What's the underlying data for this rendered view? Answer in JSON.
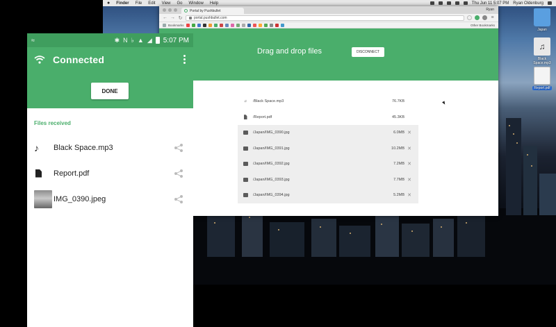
{
  "colors": {
    "pushbullet_green": "#4aae6b",
    "status_green": "#3f9e5e"
  },
  "mac": {
    "menubar": {
      "apple": "",
      "app": "Finder",
      "menus": [
        "File",
        "Edit",
        "View",
        "Go",
        "Window",
        "Help"
      ],
      "clock": "Thu Jun 11 5:07 PM",
      "user": "Ryan Oldenburg"
    },
    "desktop_icons": [
      {
        "label": "Japan",
        "icon": "folder-icon"
      },
      {
        "label": "Black Space.mp3",
        "icon": "audio-file-icon"
      },
      {
        "label": "Report.pdf",
        "icon": "pdf-file-icon"
      }
    ]
  },
  "browser": {
    "tab_title": "Portal by Pushbullet",
    "user": "Ryan",
    "url": "portal.pushbullet.com",
    "bookmarks_label": "Bookmarks",
    "other_bookmarks": "Other Bookmarks",
    "portal": {
      "title": "Drag and drop files",
      "disconnect_label": "DISCONNECT",
      "files": [
        {
          "name": "/Black Space.mp3",
          "size": "76.7KB",
          "type": "audio",
          "removable": false
        },
        {
          "name": "/Report.pdf",
          "size": "45.3KB",
          "type": "document",
          "removable": false
        },
        {
          "name": "/Japan/IMG_0390.jpg",
          "size": "6.0MB",
          "type": "image",
          "removable": true
        },
        {
          "name": "/Japan/IMG_0391.jpg",
          "size": "10.2MB",
          "type": "image",
          "removable": true
        },
        {
          "name": "/Japan/IMG_0392.jpg",
          "size": "7.2MB",
          "type": "image",
          "removable": true
        },
        {
          "name": "/Japan/IMG_0393.jpg",
          "size": "7.7MB",
          "type": "image",
          "removable": true
        },
        {
          "name": "/Japan/IMG_0394.jpg",
          "size": "5.2MB",
          "type": "image",
          "removable": true
        }
      ]
    }
  },
  "android": {
    "status_time": "5:07 PM",
    "title": "Connected",
    "done_label": "DONE",
    "section_label": "Files received",
    "files": [
      {
        "name": "Black Space.mp3",
        "icon": "music-note-icon"
      },
      {
        "name": "Report.pdf",
        "icon": "document-icon"
      },
      {
        "name": "IMG_0390.jpeg",
        "icon": "image-thumbnail"
      }
    ]
  }
}
